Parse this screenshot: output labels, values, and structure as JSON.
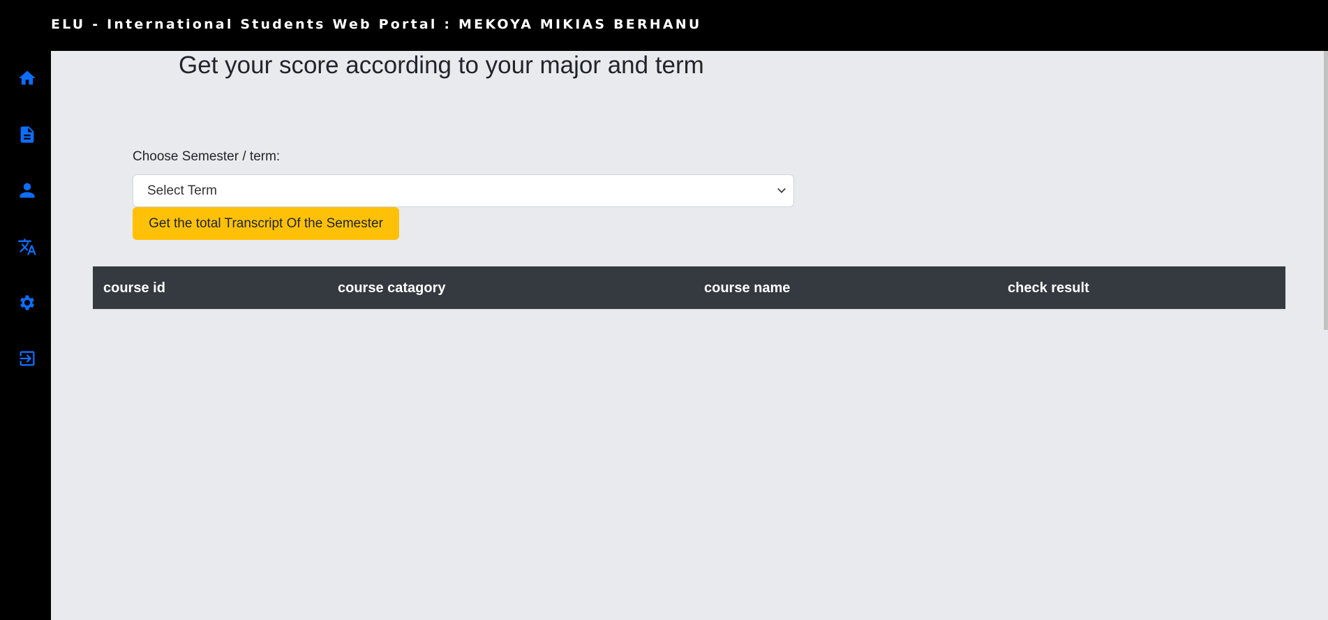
{
  "header": {
    "title": "ELU - International Students Web Portal : MEKOYA MIKIAS BERHANU"
  },
  "sidebar": {
    "items": [
      {
        "icon": "home-icon"
      },
      {
        "icon": "document-icon"
      },
      {
        "icon": "user-icon"
      },
      {
        "icon": "translate-icon"
      },
      {
        "icon": "gear-icon"
      },
      {
        "icon": "logout-icon"
      }
    ],
    "icon_color": "#0d6efd"
  },
  "main": {
    "heading": "Get your score according to your major and term",
    "term_label": "Choose Semester / term:",
    "term_select_value": "Select Term",
    "transcript_button": "Get the total Transcript Of the Semester",
    "table": {
      "columns": [
        "course id",
        "course catagory",
        "course name",
        "check result"
      ]
    }
  },
  "colors": {
    "accent": "#0d6efd",
    "button": "#ffc107",
    "table_header": "#343a40",
    "background": "#e9eaed"
  }
}
